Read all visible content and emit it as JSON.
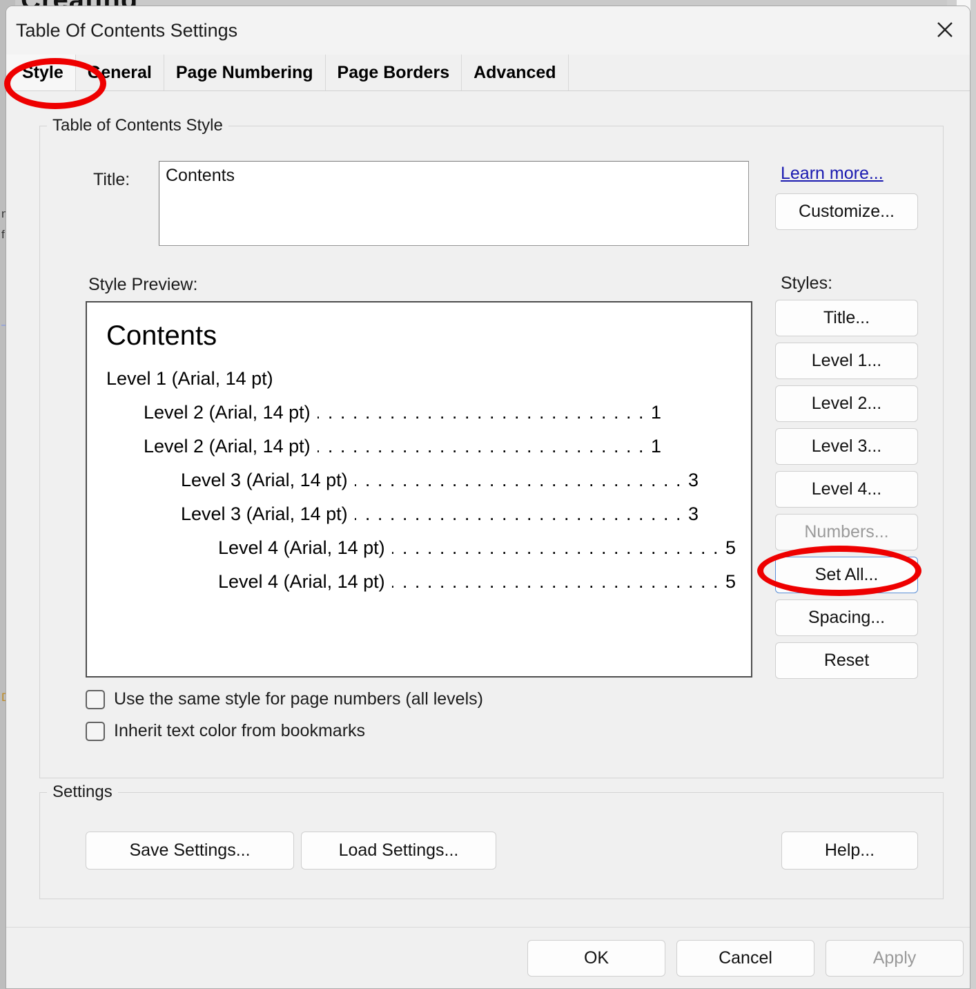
{
  "backdrop": {
    "clipped_title": "Creating",
    "left_glyphs": [
      "n",
      "f",
      "D"
    ]
  },
  "dialog": {
    "title": "Table Of Contents Settings",
    "close_icon": "close-icon"
  },
  "tabs": [
    {
      "label": "Style",
      "selected": true
    },
    {
      "label": "General",
      "selected": false
    },
    {
      "label": "Page Numbering",
      "selected": false
    },
    {
      "label": "Page Borders",
      "selected": false
    },
    {
      "label": "Advanced",
      "selected": false
    }
  ],
  "style_group": {
    "legend": "Table of Contents Style",
    "title_label": "Title:",
    "title_value": "Contents",
    "title_placeholder": "",
    "learn_more": "Learn more...",
    "customize_button": "Customize...",
    "styles_label": "Styles:",
    "style_buttons": [
      {
        "label": "Title...",
        "disabled": false,
        "focused": false
      },
      {
        "label": "Level 1...",
        "disabled": false,
        "focused": false
      },
      {
        "label": "Level 2...",
        "disabled": false,
        "focused": false
      },
      {
        "label": "Level 3...",
        "disabled": false,
        "focused": false
      },
      {
        "label": "Level 4...",
        "disabled": false,
        "focused": false
      },
      {
        "label": "Numbers...",
        "disabled": true,
        "focused": false
      },
      {
        "label": "Set All...",
        "disabled": false,
        "focused": true
      },
      {
        "label": "Spacing...",
        "disabled": false,
        "focused": false
      },
      {
        "label": "Reset",
        "disabled": false,
        "focused": false
      }
    ],
    "preview_label": "Style Preview:",
    "preview": {
      "heading": "Contents",
      "rows": [
        {
          "text": "Level 1 (Arial, 14 pt)",
          "page": "",
          "indent": 0,
          "leader": false
        },
        {
          "text": "Level 2 (Arial, 14 pt)",
          "page": "1",
          "indent": 1,
          "leader": true
        },
        {
          "text": "Level 2 (Arial, 14 pt)",
          "page": "1",
          "indent": 1,
          "leader": true
        },
        {
          "text": "Level 3 (Arial, 14 pt)",
          "page": "3",
          "indent": 2,
          "leader": true
        },
        {
          "text": "Level 3 (Arial, 14 pt)",
          "page": "3",
          "indent": 2,
          "leader": true
        },
        {
          "text": "Level 4 (Arial, 14 pt)",
          "page": "5",
          "indent": 3,
          "leader": true
        },
        {
          "text": "Level 4 (Arial, 14 pt)",
          "page": "5",
          "indent": 3,
          "leader": true
        }
      ]
    },
    "checkboxes": [
      {
        "label": "Use the same style for page numbers (all levels)",
        "checked": false
      },
      {
        "label": "Inherit text color from bookmarks",
        "checked": false
      }
    ]
  },
  "settings_group": {
    "legend": "Settings",
    "save_button": "Save Settings...",
    "load_button": "Load Settings...",
    "help_button": "Help..."
  },
  "footer": {
    "ok": "OK",
    "cancel": "Cancel",
    "apply": "Apply",
    "apply_disabled": true
  },
  "colors": {
    "dialog_bg": "#f0f0f0",
    "link": "#1a1ab0",
    "annotation": "#ee0000",
    "focus_border": "#5a8fd6",
    "disabled_text": "#9a9a9a"
  }
}
